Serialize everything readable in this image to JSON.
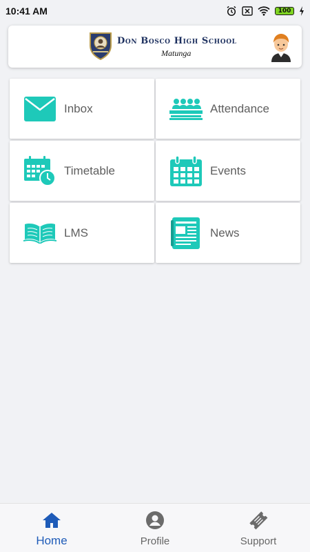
{
  "status_bar": {
    "time": "10:41 AM",
    "battery": "100",
    "icons": [
      "alarm-icon",
      "sim-off-icon",
      "wifi-icon",
      "battery-icon",
      "charging-icon"
    ]
  },
  "header": {
    "school_name": "Don Bosco High School",
    "school_location": "Matunga",
    "logo": "school-crest",
    "avatar": "student-avatar"
  },
  "tiles": [
    {
      "label": "Inbox",
      "icon": "envelope-icon"
    },
    {
      "label": "Attendance",
      "icon": "attendance-icon"
    },
    {
      "label": "Timetable",
      "icon": "calendar-clock-icon"
    },
    {
      "label": "Events",
      "icon": "calendar-icon"
    },
    {
      "label": "LMS",
      "icon": "open-book-icon"
    },
    {
      "label": "News",
      "icon": "newspaper-icon"
    }
  ],
  "bottom_nav": {
    "items": [
      {
        "label": "Home",
        "icon": "home-icon",
        "active": true
      },
      {
        "label": "Profile",
        "icon": "profile-icon",
        "active": false
      },
      {
        "label": "Support",
        "icon": "ticket-icon",
        "active": false
      }
    ]
  },
  "colors": {
    "accent": "#1ec9b9",
    "active_nav": "#1e5bb8",
    "school_name": "#1c2f5e",
    "background": "#f1f2f5"
  }
}
